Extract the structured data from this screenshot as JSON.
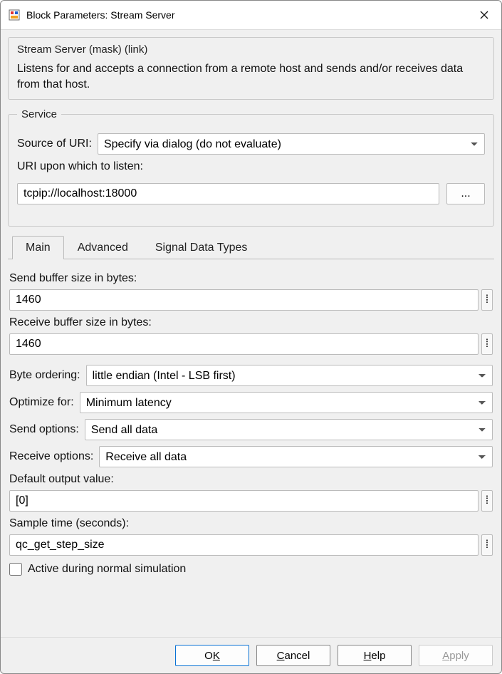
{
  "window": {
    "title": "Block Parameters: Stream Server"
  },
  "mask": {
    "heading": "Stream Server (mask) (link)",
    "description": "Listens for and accepts a connection from a remote host and sends and/or receives data from that host."
  },
  "service": {
    "legend": "Service",
    "source_label": "Source of URI:",
    "source_value": "Specify via dialog (do not evaluate)",
    "uri_label": "URI upon which to listen:",
    "uri_value": "tcpip://localhost:18000",
    "ellipsis": "..."
  },
  "tabs": {
    "items": [
      "Main",
      "Advanced",
      "Signal Data Types"
    ],
    "active": 0
  },
  "main": {
    "send_buf_label": "Send buffer size in bytes:",
    "send_buf_value": "1460",
    "recv_buf_label": "Receive buffer size in bytes:",
    "recv_buf_value": "1460",
    "byte_order_label": "Byte ordering:",
    "byte_order_value": "little endian (Intel - LSB first)",
    "optimize_label": "Optimize for:",
    "optimize_value": "Minimum latency",
    "send_opt_label": "Send options:",
    "send_opt_value": "Send all data",
    "recv_opt_label": "Receive options:",
    "recv_opt_value": "Receive all data",
    "default_out_label": "Default output value:",
    "default_out_value": "[0]",
    "sample_time_label": "Sample time (seconds):",
    "sample_time_value": "qc_get_step_size",
    "active_sim_label": "Active during normal simulation"
  },
  "buttons": {
    "ok_pre": "O",
    "ok_u": "K",
    "cancel_u": "C",
    "cancel_post": "ancel",
    "help_u": "H",
    "help_post": "elp",
    "apply_u": "A",
    "apply_post": "pply"
  },
  "icons": {
    "colon": "⁞"
  }
}
